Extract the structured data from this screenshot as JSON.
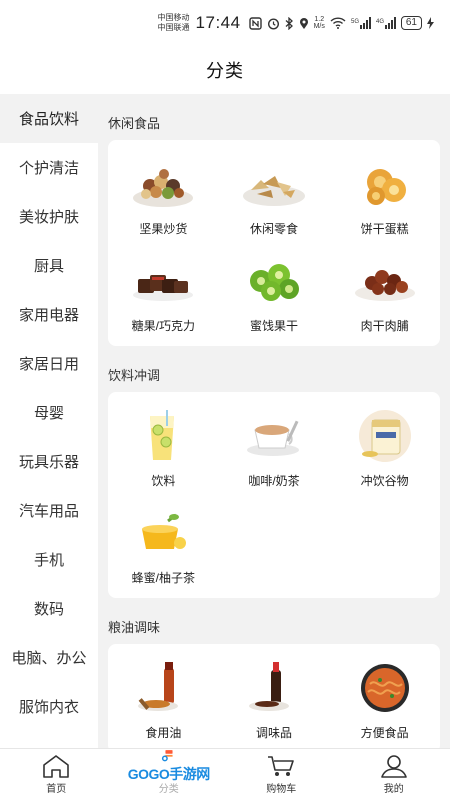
{
  "status_bar": {
    "carrier_1": "中国移动",
    "carrier_2": "中国联通",
    "time": "17:44",
    "speed_value": "1.2",
    "speed_unit": "M/s",
    "battery": "61"
  },
  "header": {
    "title": "分类"
  },
  "sidebar": {
    "items": [
      {
        "label": "食品饮料",
        "active": true
      },
      {
        "label": "个护清洁"
      },
      {
        "label": "美妆护肤"
      },
      {
        "label": "厨具"
      },
      {
        "label": "家用电器"
      },
      {
        "label": "家居日用"
      },
      {
        "label": "母婴"
      },
      {
        "label": "玩具乐器"
      },
      {
        "label": "汽车用品"
      },
      {
        "label": "手机"
      },
      {
        "label": "数码"
      },
      {
        "label": "电脑、办公"
      },
      {
        "label": "服饰内衣"
      }
    ]
  },
  "sections": [
    {
      "title": "休闲食品",
      "items": [
        {
          "label": "坚果炒货",
          "icon": "nuts-icon"
        },
        {
          "label": "休闲零食",
          "icon": "chips-icon"
        },
        {
          "label": "饼干蛋糕",
          "icon": "cookies-icon"
        },
        {
          "label": "糖果/巧克力",
          "icon": "chocolate-icon"
        },
        {
          "label": "蜜饯果干",
          "icon": "kiwi-icon"
        },
        {
          "label": "肉干肉脯",
          "icon": "jerky-icon"
        }
      ]
    },
    {
      "title": "饮料冲调",
      "items": [
        {
          "label": "饮料",
          "icon": "drink-icon"
        },
        {
          "label": "咖啡/奶茶",
          "icon": "coffee-icon"
        },
        {
          "label": "冲饮谷物",
          "icon": "cereal-icon"
        },
        {
          "label": "蜂蜜/柚子茶",
          "icon": "honey-icon"
        }
      ]
    },
    {
      "title": "粮油调味",
      "items": [
        {
          "label": "食用油",
          "icon": "oil-icon"
        },
        {
          "label": "调味品",
          "icon": "soy-sauce-icon"
        },
        {
          "label": "方便食品",
          "icon": "noodles-icon"
        }
      ]
    }
  ],
  "bottom_nav": {
    "items": [
      {
        "label": "首页",
        "icon": "home-icon"
      },
      {
        "label": "分类",
        "icon": "category-icon"
      },
      {
        "label": "购物车",
        "icon": "cart-icon"
      },
      {
        "label": "我的",
        "icon": "user-icon"
      }
    ],
    "watermark": "GOGO手游网"
  }
}
